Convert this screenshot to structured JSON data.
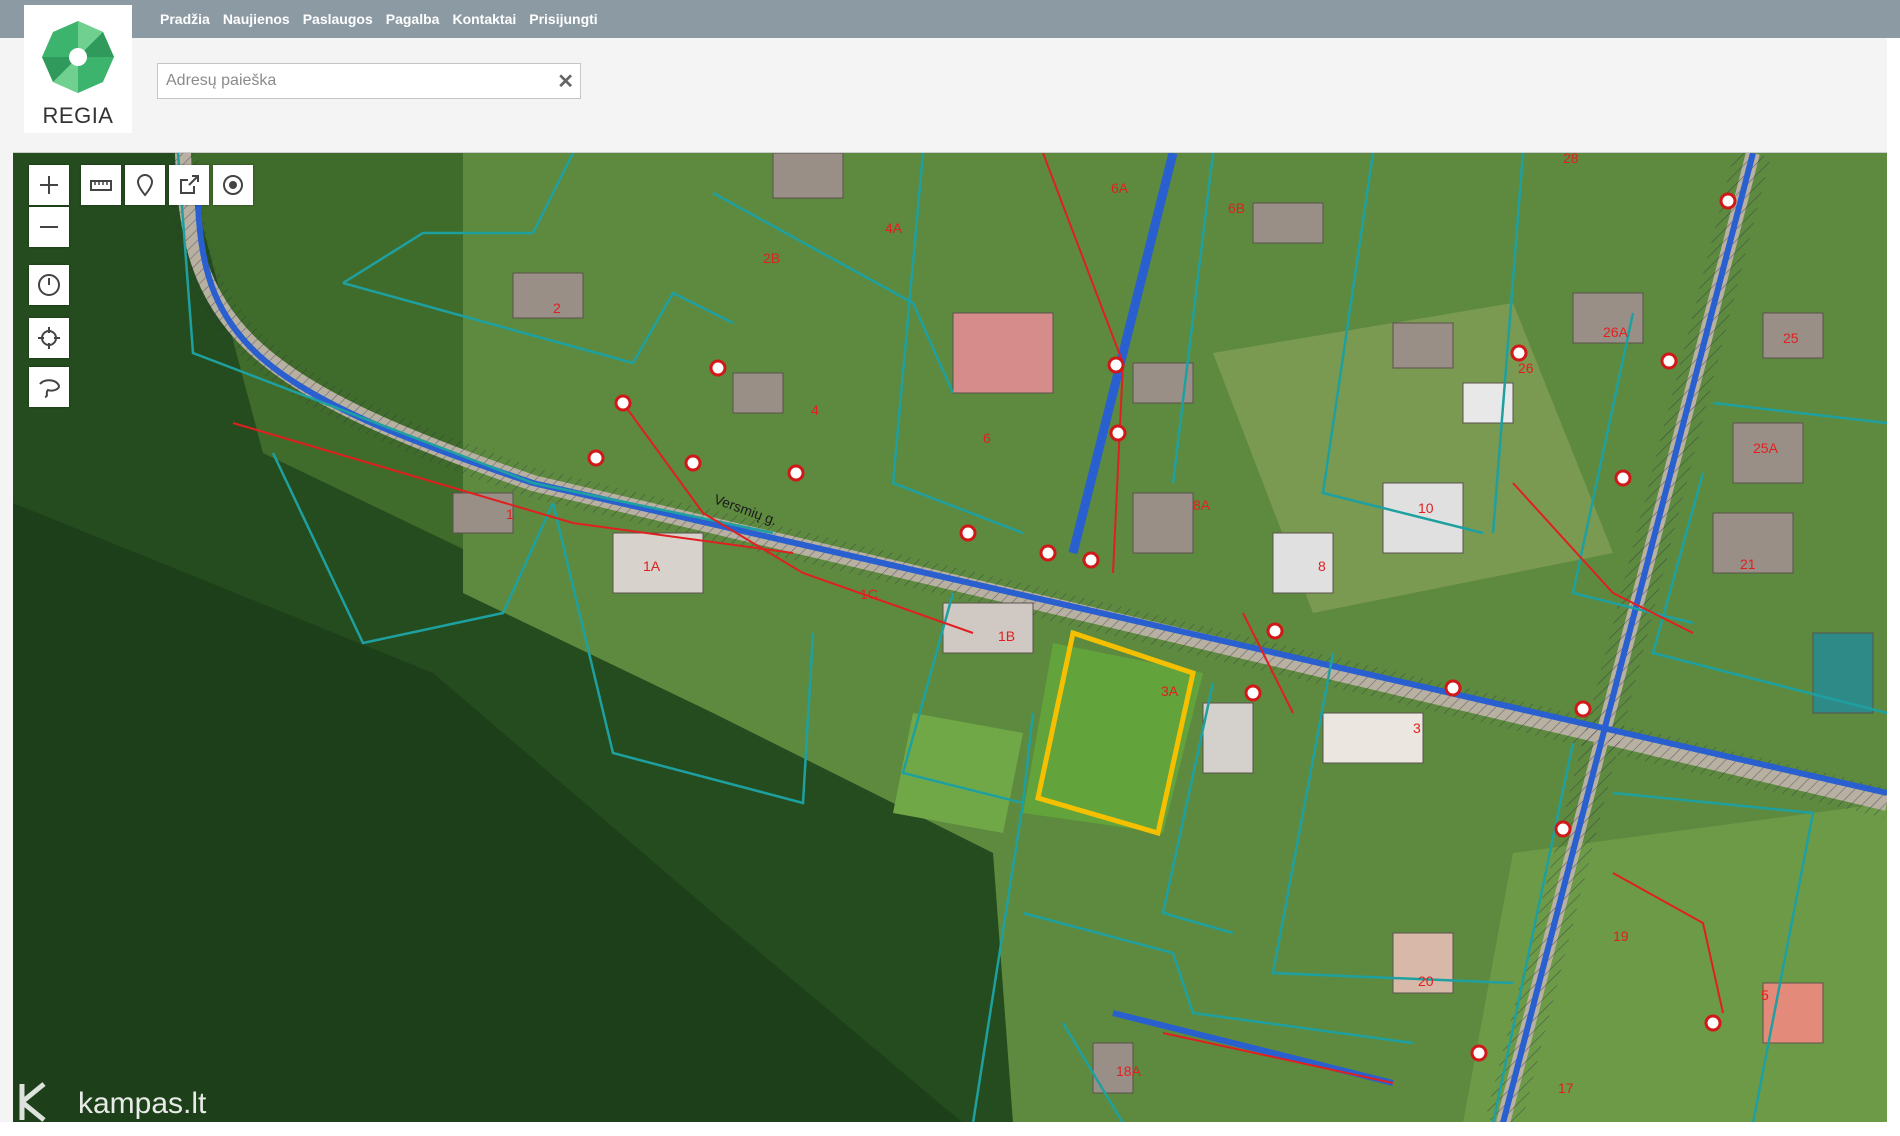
{
  "nav": [
    "Pradžia",
    "Naujienos",
    "Paslaugos",
    "Pagalba",
    "Kontaktai",
    "Prisijungti"
  ],
  "logo": {
    "text": "REGIA",
    "color": "#3cb46e"
  },
  "search": {
    "placeholder": "Adresų paieška",
    "value": "",
    "clear_icon": "close-icon"
  },
  "map": {
    "street_label": "Versmių g.",
    "parcel_labels": [
      "28",
      "6A",
      "4A",
      "6B",
      "2B",
      "2",
      "26A",
      "25",
      "26",
      "4",
      "6",
      "8A",
      "25A",
      "10",
      "1",
      "1A",
      "8",
      "21",
      "1C",
      "1B",
      "3A",
      "3",
      "19",
      "20",
      "5",
      "18A",
      "17"
    ],
    "selected_parcel": "3A",
    "colors": {
      "parcel": "#1fa0a0",
      "selected": "#f5c000",
      "network": "#e02020",
      "road": "#2a5fd0"
    }
  },
  "controls": [
    "zoom-in-icon",
    "zoom-out-icon",
    "ruler-icon",
    "pin-icon",
    "export-icon",
    "target-icon",
    "clock-icon",
    "locate-icon",
    "lasso-icon"
  ],
  "watermark": "kampas.lt"
}
